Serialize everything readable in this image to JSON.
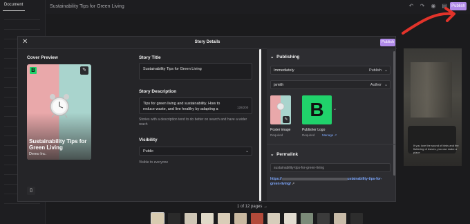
{
  "editor": {
    "left_tab": "Document",
    "story_title": "Sustainability Tips for Green Living",
    "publish_label": "Publish",
    "pages_text": "1 of 12 pages",
    "bg_caption": "If you love the sound of birds and the fluttering of leaves, you can make a place",
    "thumb_colors": [
      "#d8cbb0",
      "#2a2a2a",
      "#cfc6b5",
      "#e0d9c8",
      "#d9cdb8",
      "#c9b8a0",
      "#b24a3a",
      "#d6cdbb",
      "#e2dcd0",
      "#7b8a78",
      "#3b3b3b",
      "#c8bba8",
      "#2d2d2d"
    ]
  },
  "modal": {
    "title": "Story Details",
    "publish_label": "Publish",
    "cover": {
      "heading": "Cover Preview",
      "logo_letter": "B",
      "title": "Sustainability Tips for Green Living",
      "publisher": "Demo Inc."
    },
    "story_title": {
      "heading": "Story Title",
      "value": "Sustainability Tips for Green Living"
    },
    "description": {
      "heading": "Story Description",
      "value": "Tips for green living and sustainability. How to reduce waste, and live healthy by adapting a",
      "counter": "128/200",
      "helper": "Stories with a description tend to do better on search and have a wider reach"
    },
    "visibility": {
      "heading": "Visibility",
      "value": "Public",
      "helper": "Visible to everyone"
    },
    "publishing": {
      "heading": "Publishing",
      "when_value": "Immediately",
      "when_action": "Publish",
      "author_value": "jsmith",
      "author_role": "Author",
      "poster_label": "Poster image",
      "poster_sub": "Required",
      "publisher_logo_letter": "B",
      "publisher_logo_label": "Publisher Logo",
      "publisher_logo_sub": "Required",
      "manage_label": "Manage"
    },
    "permalink": {
      "heading": "Permalink",
      "slug": "sustainability-tips-for-green-living",
      "url_prefix": "https://",
      "url_suffix_1": "ustainability-tips-for-",
      "url_suffix_2": "green-living/"
    }
  }
}
